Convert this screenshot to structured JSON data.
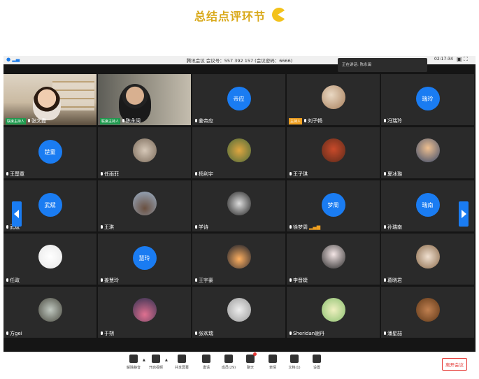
{
  "banner": {
    "title": "总结点评环节"
  },
  "window": {
    "title": "腾讯会议 会议号：557 392 157 (会议密码：6666)",
    "time": "02:17:34",
    "speaking": "正在讲话: 陈永闽"
  },
  "tiles": [
    {
      "id": "t1",
      "name": "张文霞",
      "tag": "联席主持人",
      "tag_color": "green",
      "kind": "video"
    },
    {
      "id": "t2",
      "name": "陈永闽",
      "tag": "联席主持人",
      "tag_color": "green",
      "kind": "video"
    },
    {
      "id": "t3",
      "name": "姜帝应",
      "avatar": "帝应",
      "kind": "text"
    },
    {
      "id": "t4",
      "name": "刘子畅",
      "tag": "主持人",
      "tag_color": "orange",
      "kind": "photo"
    },
    {
      "id": "t5",
      "name": "冯瑞玲",
      "avatar": "瑞玲",
      "kind": "text"
    },
    {
      "id": "t6",
      "name": "王楚童",
      "avatar": "楚童",
      "kind": "text"
    },
    {
      "id": "t7",
      "name": "任雨菲",
      "kind": "photo"
    },
    {
      "id": "t8",
      "name": "杨利宇",
      "kind": "photo"
    },
    {
      "id": "t9",
      "name": "王子琪",
      "kind": "photo"
    },
    {
      "id": "t10",
      "name": "夏冰璐",
      "kind": "photo"
    },
    {
      "id": "t11",
      "name": "武斌",
      "avatar": "武斌",
      "kind": "text"
    },
    {
      "id": "t12",
      "name": "王琪",
      "kind": "photo"
    },
    {
      "id": "t13",
      "name": "学诗",
      "kind": "photo"
    },
    {
      "id": "t14",
      "name": "徐梦周",
      "avatar": "梦周",
      "kind": "text",
      "signal": true
    },
    {
      "id": "t15",
      "name": "孙瑞南",
      "avatar": "瑞南",
      "kind": "text"
    },
    {
      "id": "t16",
      "name": "任政",
      "kind": "photo"
    },
    {
      "id": "t17",
      "name": "姜慧玲",
      "avatar": "慧玲",
      "kind": "text"
    },
    {
      "id": "t18",
      "name": "王宇豪",
      "kind": "photo"
    },
    {
      "id": "t19",
      "name": "李晋婕",
      "kind": "photo"
    },
    {
      "id": "t20",
      "name": "葛晓君",
      "kind": "photo"
    },
    {
      "id": "t21",
      "name": "方gei",
      "kind": "photo"
    },
    {
      "id": "t22",
      "name": "于朔",
      "kind": "photo"
    },
    {
      "id": "t23",
      "name": "张欢瑞",
      "kind": "photo"
    },
    {
      "id": "t24",
      "name": "Sheridan谢丹",
      "kind": "photo"
    },
    {
      "id": "t25",
      "name": "潘星喆",
      "kind": "photo"
    }
  ],
  "toolbar": {
    "items": [
      {
        "label": "解除静音",
        "icon": "mic-icon"
      },
      {
        "label": "开启视频",
        "icon": "camera-off-icon"
      },
      {
        "label": "共享屏幕",
        "icon": "share-screen-icon"
      },
      {
        "label": "邀请",
        "icon": "invite-icon"
      },
      {
        "label": "成员(29)",
        "icon": "members-icon"
      },
      {
        "label": "聊天",
        "icon": "chat-icon"
      },
      {
        "label": "表情",
        "icon": "emoji-icon"
      },
      {
        "label": "文档(1)",
        "icon": "document-icon"
      },
      {
        "label": "设置",
        "icon": "settings-icon"
      }
    ],
    "leave_label": "离开会议"
  },
  "colors": {
    "accent": "#1a7cf2",
    "banner": "#d9a91a",
    "leave": "#e53935",
    "host_tag": "#f0a020",
    "cohost_tag": "#1e9a4e"
  }
}
